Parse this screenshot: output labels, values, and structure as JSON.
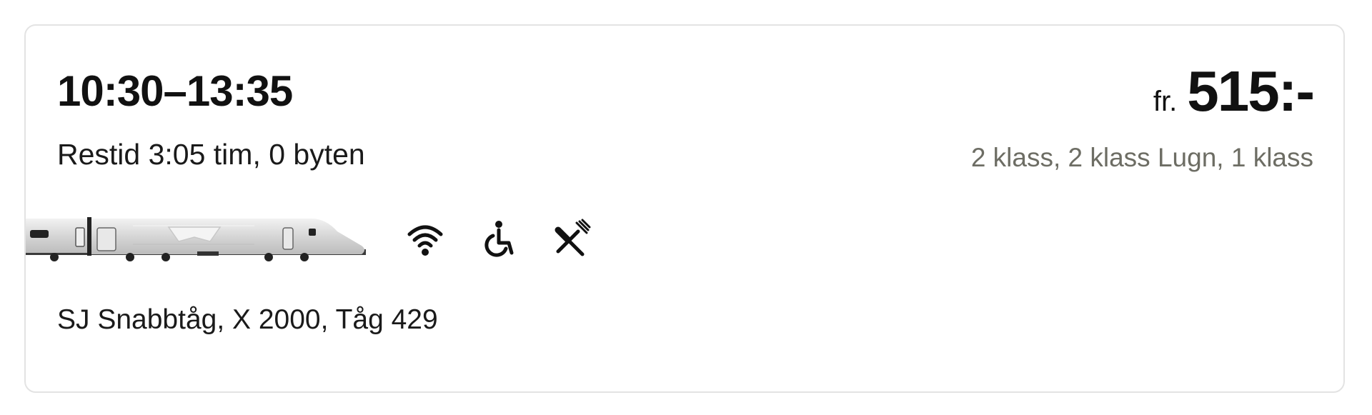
{
  "journey": {
    "times": "10:30–13:35",
    "duration": "Restid 3:05 tim, 0 byten",
    "price_prefix": "fr.",
    "price": "515:-",
    "classes": "2 klass, 2 klass Lugn, 1 klass",
    "train_name": "SJ Snabbtåg, X 2000, Tåg 429",
    "amenities": [
      "wifi-icon",
      "wheelchair-icon",
      "no-food-icon"
    ]
  },
  "colors": {
    "text": "#111111",
    "muted": "#6d6d64",
    "border": "#e3e3e3",
    "train_body": "#dcdcdc"
  }
}
